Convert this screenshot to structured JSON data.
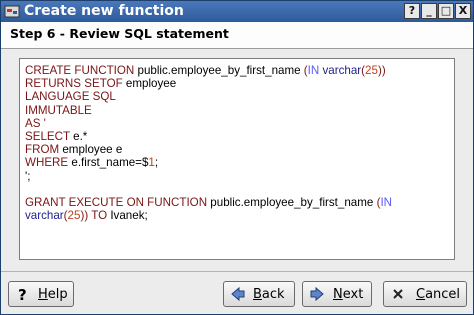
{
  "window": {
    "title": "Create new function",
    "controls": [
      "?",
      "_",
      "□",
      "X"
    ]
  },
  "step": {
    "title": "Step 6 - Review SQL statement"
  },
  "sql": {
    "lines": [
      [
        [
          "kw",
          "CREATE FUNCTION "
        ],
        [
          "tx",
          "public.employee_by_first_name "
        ],
        [
          "kw",
          "("
        ],
        [
          "pm",
          "IN"
        ],
        [
          "tx",
          " "
        ],
        [
          "ty",
          "varchar"
        ],
        [
          "kw",
          "("
        ],
        [
          "nm",
          "25"
        ],
        [
          "kw",
          "))"
        ]
      ],
      [
        [
          "kw",
          "RETURNS SETOF "
        ],
        [
          "tx",
          "employee"
        ]
      ],
      [
        [
          "kw",
          "LANGUAGE SQL"
        ]
      ],
      [
        [
          "kw",
          "IMMUTABLE"
        ]
      ],
      [
        [
          "kw",
          "AS '"
        ]
      ],
      [
        [
          "kw",
          "SELECT "
        ],
        [
          "tx",
          "e.*"
        ]
      ],
      [
        [
          "kw",
          "FROM "
        ],
        [
          "tx",
          "employee e"
        ]
      ],
      [
        [
          "kw",
          "WHERE "
        ],
        [
          "tx",
          "e.first_name=$"
        ],
        [
          "nm",
          "1"
        ],
        [
          "tx",
          ";"
        ]
      ],
      [
        [
          "tx",
          "';"
        ]
      ],
      [
        [
          "tx",
          ""
        ]
      ],
      [
        [
          "kw",
          "GRANT EXECUTE ON FUNCTION "
        ],
        [
          "tx",
          "public.employee_by_first_name "
        ],
        [
          "kw",
          "("
        ],
        [
          "pm",
          "IN"
        ]
      ],
      [
        [
          "ty",
          "varchar"
        ],
        [
          "kw",
          "("
        ],
        [
          "nm",
          "25"
        ],
        [
          "kw",
          "))"
        ],
        [
          "tx",
          " "
        ],
        [
          "kw",
          "TO "
        ],
        [
          "tx",
          "Ivanek;"
        ]
      ]
    ]
  },
  "buttons": {
    "help": {
      "first": "H",
      "rest": "elp"
    },
    "back": {
      "first": "B",
      "rest": "ack"
    },
    "next": {
      "first": "N",
      "rest": "ext"
    },
    "cancel": {
      "first": "C",
      "rest": "ancel"
    }
  },
  "colors": {
    "titlebar": "#3a67a8",
    "keyword": "#7a1515",
    "type": "#1d1d8a",
    "param_mode": "#5a5aff",
    "number": "#c04020"
  }
}
